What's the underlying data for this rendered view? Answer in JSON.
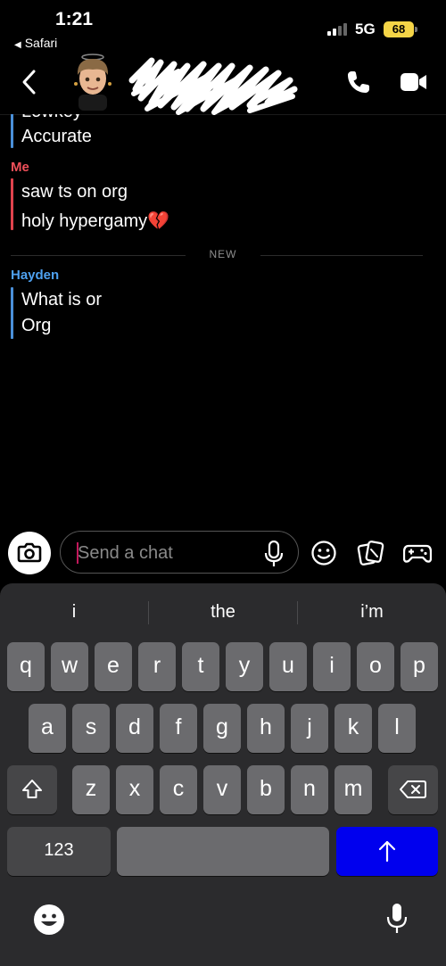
{
  "status_bar": {
    "time": "1:21",
    "back_app": "Safari",
    "network": "5G",
    "battery": "68"
  },
  "chat_header": {
    "back_icon": "chevron-left-icon",
    "call_icon": "phone-icon",
    "video_icon": "video-camera-icon"
  },
  "messages": [
    {
      "sender": "",
      "bar_color": "#4a90d9",
      "lines": [
        "Lowkey",
        "Accurate"
      ]
    },
    {
      "sender": "Me",
      "sender_color": "#f0505a",
      "bar_color": "#e0434d",
      "lines": [
        "saw ts on org",
        "holy hypergamy💔"
      ]
    },
    {
      "sender": "Hayden",
      "sender_color": "#4ea1f0",
      "bar_color": "#4a90d9",
      "lines": [
        "What is or",
        "Org"
      ]
    }
  ],
  "new_divider": "NEW",
  "composer": {
    "placeholder": "Send a chat",
    "icons": [
      "camera-icon",
      "microphone-icon",
      "emoji-icon",
      "sticker-icon",
      "game-controller-icon"
    ]
  },
  "keyboard": {
    "suggestions": [
      "i",
      "the",
      "i’m"
    ],
    "row1": [
      "q",
      "w",
      "e",
      "r",
      "t",
      "y",
      "u",
      "i",
      "o",
      "p"
    ],
    "row2": [
      "a",
      "s",
      "d",
      "f",
      "g",
      "h",
      "j",
      "k",
      "l"
    ],
    "row3": [
      "z",
      "x",
      "c",
      "v",
      "b",
      "n",
      "m"
    ],
    "numbers_key": "123",
    "accent_color": "#0000ee"
  }
}
